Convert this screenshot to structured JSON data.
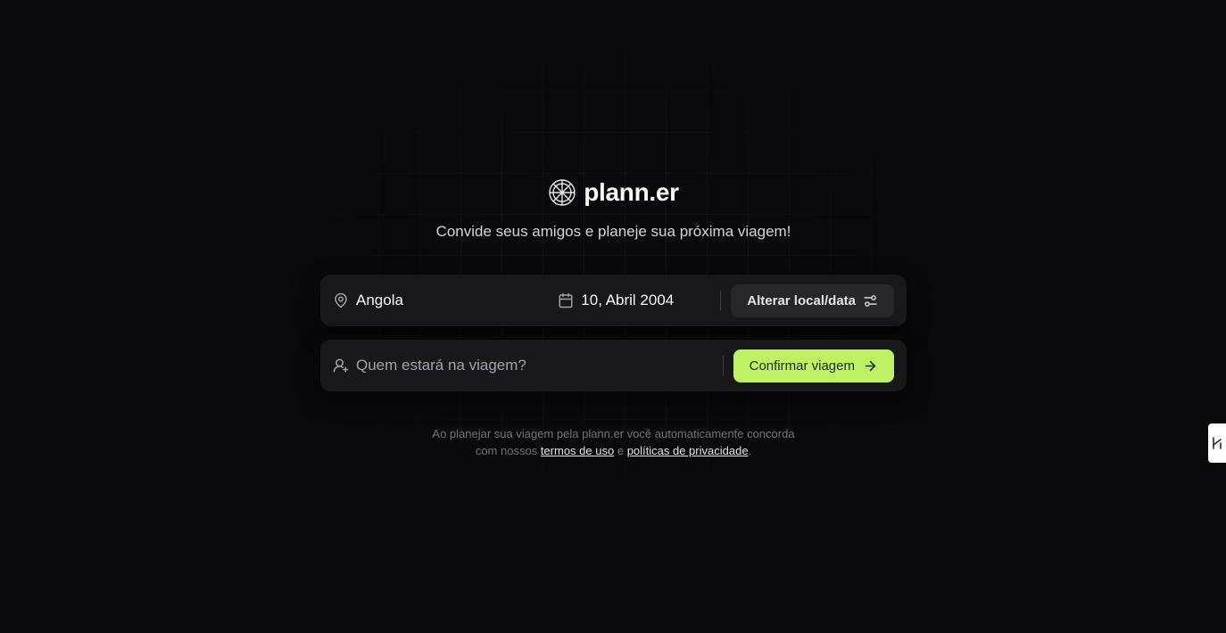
{
  "brand": {
    "name": "plann.er",
    "icon": "globe-icon"
  },
  "tagline": "Convide seus amigos e planeje sua próxima viagem!",
  "destination_bar": {
    "location": {
      "icon": "map-pin-icon",
      "value": "Angola"
    },
    "date": {
      "icon": "calendar-icon",
      "value": "10, Abril 2004"
    },
    "change_button": {
      "label": "Alterar local/data",
      "icon": "settings-sliders-icon"
    }
  },
  "guests_bar": {
    "input": {
      "icon": "user-plus-icon",
      "placeholder": "Quem estará na viagem?",
      "value": ""
    },
    "confirm_button": {
      "label": "Confirmar viagem",
      "icon": "arrow-right-icon"
    }
  },
  "legal": {
    "line1": "Ao planejar sua viagem pela plann.er você automaticamente concorda",
    "line2_prefix": "com nossos",
    "terms_link": "termos de uso",
    "conjunction": "e",
    "privacy_link": "políticas de privacidade",
    "period": "."
  },
  "colors": {
    "background": "#09090b",
    "surface": "#18181b",
    "accent": "#bef264",
    "secondary_button": "#27272a"
  }
}
